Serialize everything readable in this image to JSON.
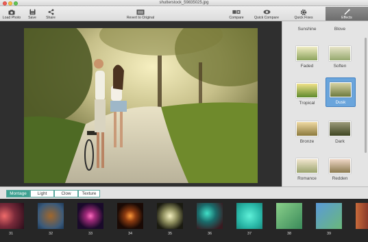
{
  "window": {
    "title": "shutterstock_59835025.jpg"
  },
  "toolbar": {
    "load_photo": "Load Photo",
    "save": "Save",
    "share": "Share",
    "revert": "Revert to Original",
    "compare": "Compare",
    "quick_compare": "Quick Compare",
    "quick_fixes": "Quick Fixes",
    "effects": "Effects"
  },
  "effects_panel": {
    "items": [
      {
        "name": "Sunshine"
      },
      {
        "name": "Blove"
      },
      {
        "name": "Faded"
      },
      {
        "name": "Soften"
      },
      {
        "name": "Tropical"
      },
      {
        "name": "Dusk",
        "selected": true
      },
      {
        "name": "Bronze"
      },
      {
        "name": "Dark"
      },
      {
        "name": "Romance"
      },
      {
        "name": "Redden"
      }
    ]
  },
  "bottom_tabs": [
    {
      "label": "Montage",
      "active": true
    },
    {
      "label": "Light"
    },
    {
      "label": "Clow"
    },
    {
      "label": "Texture"
    }
  ],
  "textures": [
    {
      "number": "31"
    },
    {
      "number": "32"
    },
    {
      "number": "33"
    },
    {
      "number": "34"
    },
    {
      "number": "35"
    },
    {
      "number": "36"
    },
    {
      "number": "37"
    },
    {
      "number": "38"
    },
    {
      "number": "39"
    }
  ],
  "colors": {
    "accent": "#3fa191",
    "selection": "#6aa5dc"
  }
}
